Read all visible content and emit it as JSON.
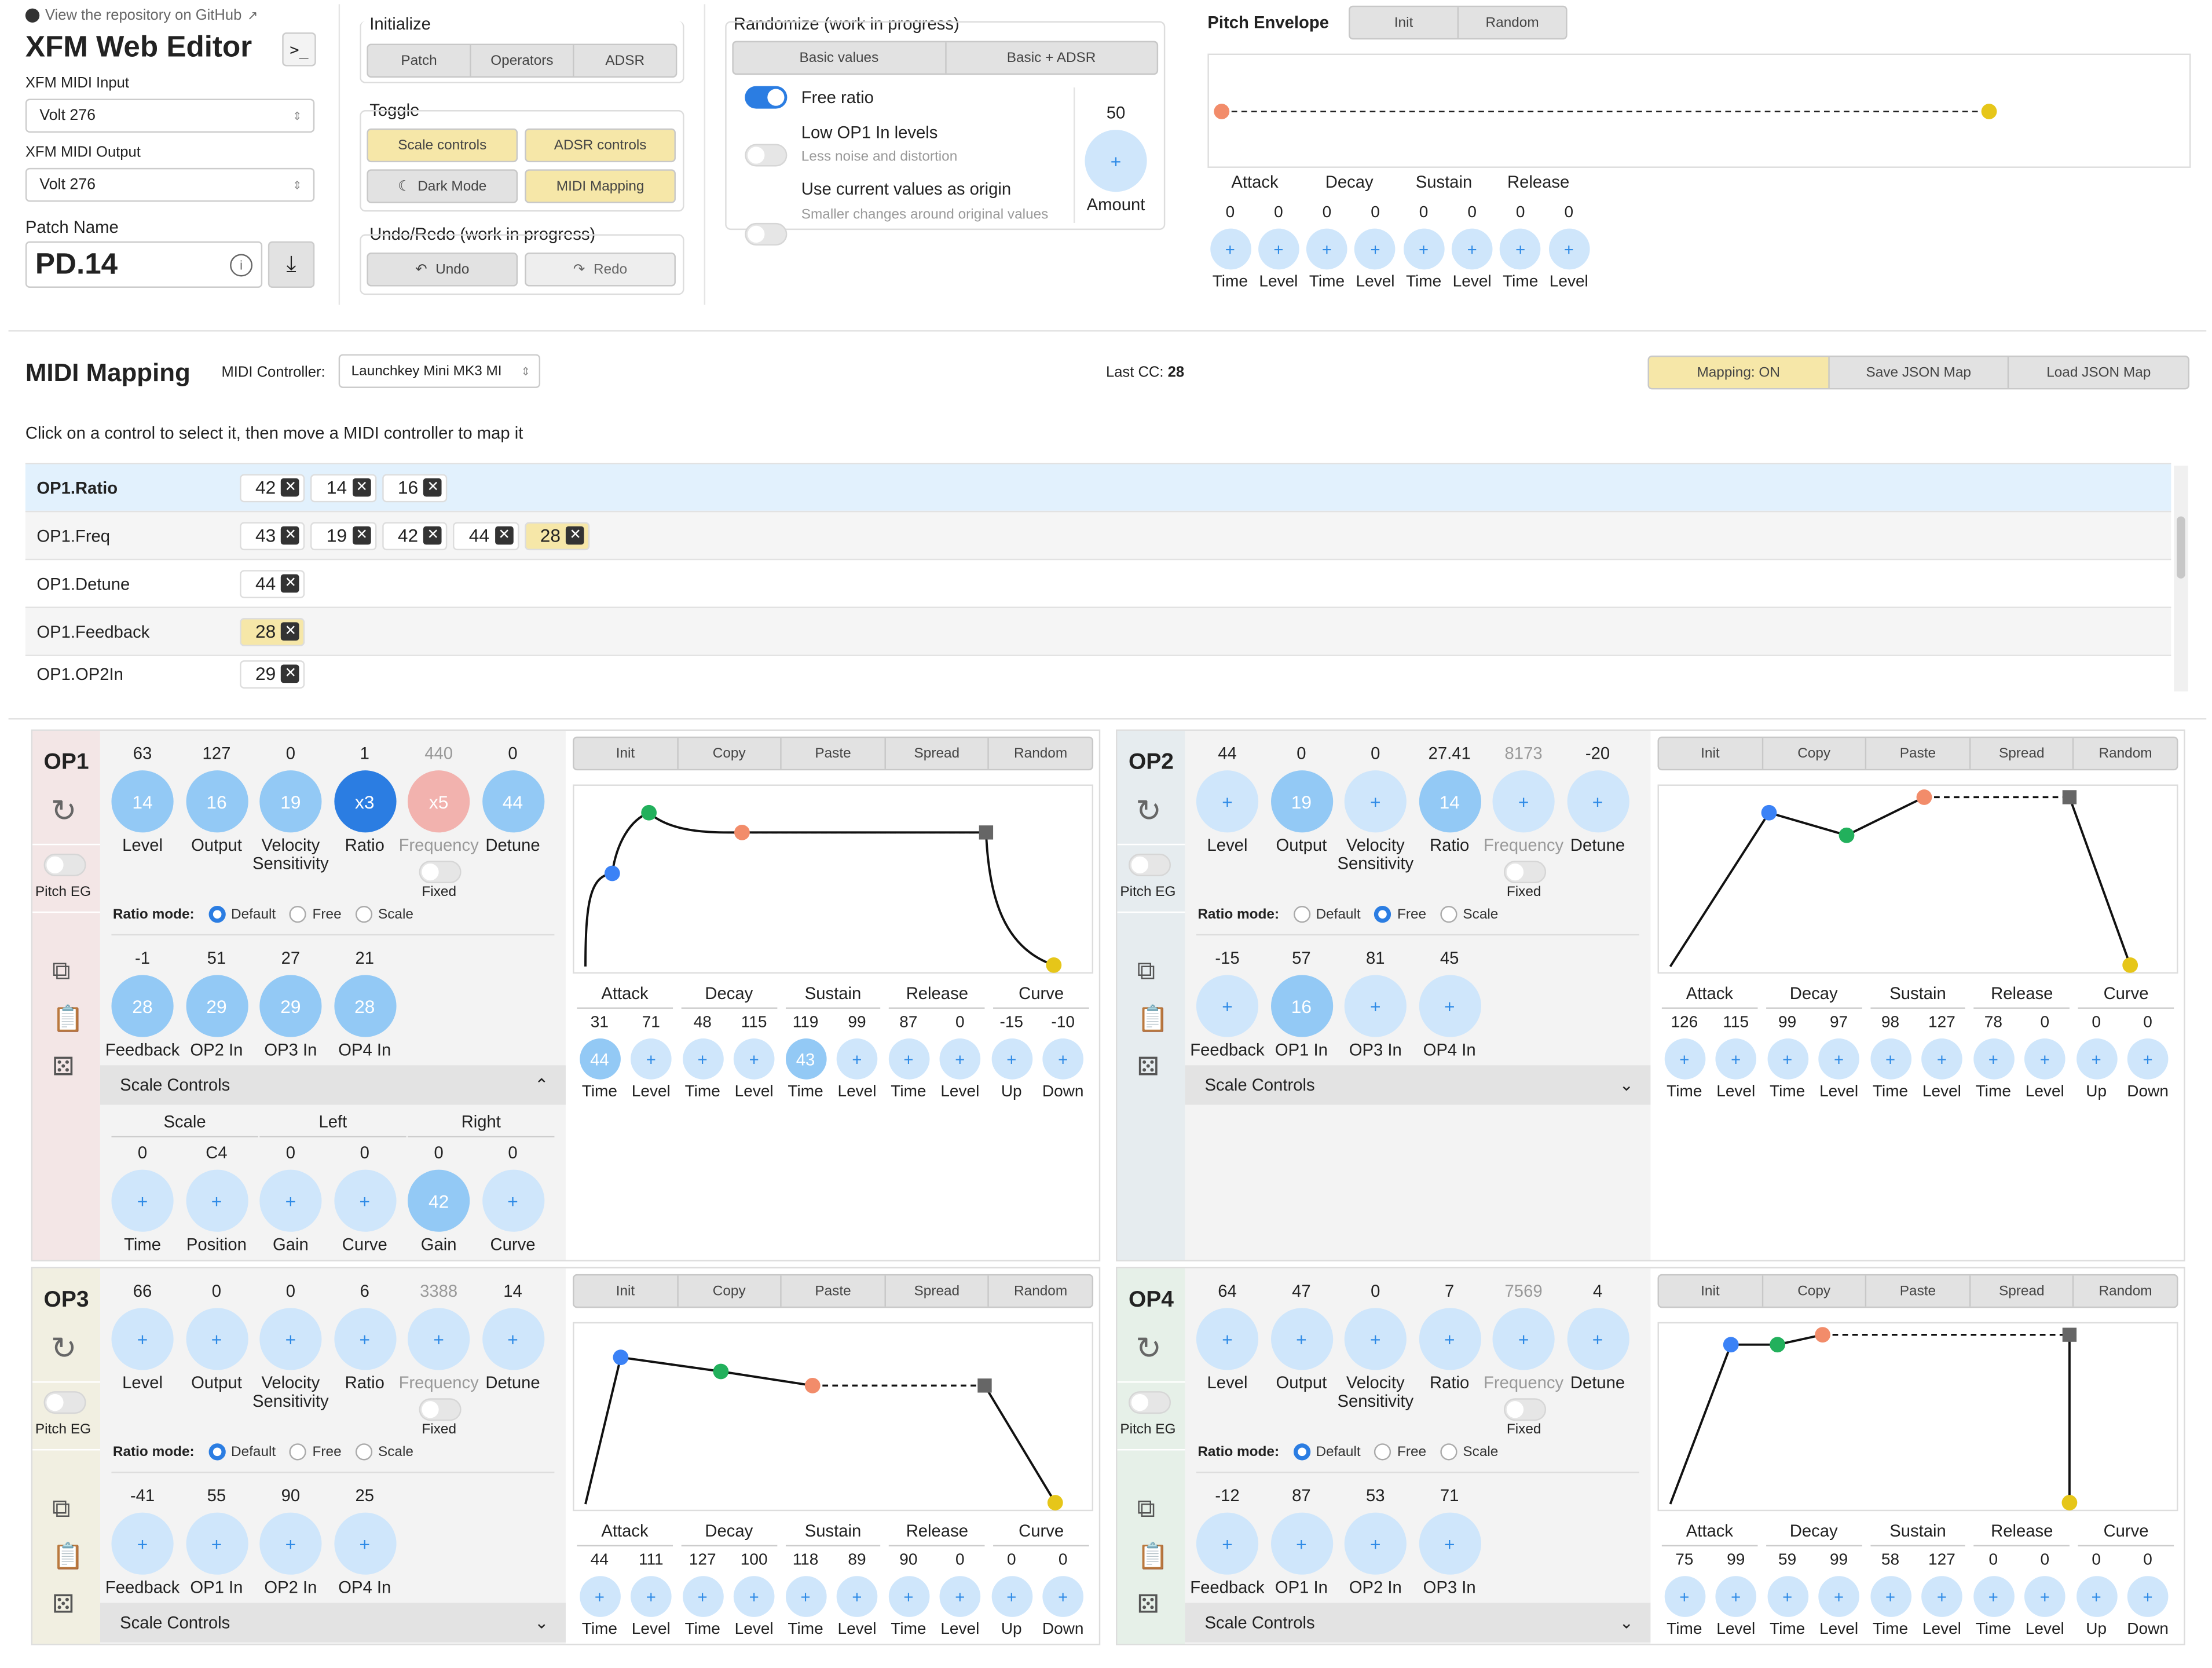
{
  "header": {
    "repo_link": "View the repository on GitHub",
    "title": "XFM Web Editor",
    "midi_input_label": "XFM MIDI Input",
    "midi_input_value": "Volt 276",
    "midi_output_label": "XFM MIDI Output",
    "midi_output_value": "Volt 276",
    "patch_name_label": "Patch Name",
    "patch_name_value": "PD.14"
  },
  "initialize": {
    "title": "Initialize",
    "buttons": [
      "Patch",
      "Operators",
      "ADSR"
    ]
  },
  "toggle": {
    "title": "Toggle",
    "scale_controls": "Scale controls",
    "adsr_controls": "ADSR controls",
    "dark_mode": "Dark Mode",
    "midi_mapping": "MIDI Mapping"
  },
  "undo": {
    "title": "Undo/Redo (work in progress)",
    "undo": "Undo",
    "redo": "Redo"
  },
  "randomize": {
    "title": "Randomize (work in progress)",
    "basic_values": "Basic values",
    "basic_adsr": "Basic + ADSR",
    "free_ratio": "Free ratio",
    "low_op1": "Low OP1 In levels",
    "low_op1_sub": "Less noise and distortion",
    "use_current": "Use current values as origin",
    "use_current_sub": "Smaller changes around original values",
    "amount_value": "50",
    "amount_label": "Amount",
    "free_ratio_on": true
  },
  "pitch_env": {
    "title": "Pitch Envelope",
    "init": "Init",
    "random": "Random",
    "headers": [
      "Attack",
      "Decay",
      "Sustain",
      "Release"
    ],
    "values": [
      "0",
      "0",
      "0",
      "0",
      "0",
      "0",
      "0",
      "0"
    ],
    "labels": [
      "Time",
      "Level",
      "Time",
      "Level",
      "Time",
      "Level",
      "Time",
      "Level"
    ]
  },
  "midi_mapping": {
    "title": "MIDI Mapping",
    "controller_label": "MIDI Controller:",
    "controller_value": "Launchkey Mini MK3 MI",
    "last_cc_label": "Last CC:",
    "last_cc_value": "28",
    "mapping_on": "Mapping: ON",
    "save": "Save JSON Map",
    "load": "Load JSON Map",
    "hint": "Click on a control to select it, then move a MIDI controller to map it",
    "rows": [
      {
        "name": "OP1.Ratio",
        "chips": [
          "42",
          "14",
          "16"
        ],
        "hl": []
      },
      {
        "name": "OP1.Freq",
        "chips": [
          "43",
          "19",
          "42",
          "44",
          "28"
        ],
        "hl": [
          4
        ]
      },
      {
        "name": "OP1.Detune",
        "chips": [
          "44"
        ],
        "hl": []
      },
      {
        "name": "OP1.Feedback",
        "chips": [
          "28"
        ],
        "hl": [
          0
        ]
      },
      {
        "name": "OP1.OP2In",
        "chips": [
          "29"
        ],
        "hl": []
      }
    ]
  },
  "common": {
    "ratio_mode": "Ratio mode:",
    "modes": [
      "Default",
      "Free",
      "Scale"
    ],
    "fixed": "Fixed",
    "pitch_eg": "Pitch EG",
    "scale_controls": "Scale Controls",
    "env_buttons": [
      "Init",
      "Copy",
      "Paste",
      "Spread",
      "Random"
    ],
    "env_headers": [
      "Attack",
      "Decay",
      "Sustain",
      "Release",
      "Curve"
    ],
    "env_labels": [
      "Time",
      "Level",
      "Time",
      "Level",
      "Time",
      "Level",
      "Time",
      "Level",
      "Up",
      "Down"
    ],
    "main_labels": [
      "Level",
      "Output",
      "Velocity\nSensitivity",
      "Ratio",
      "Frequency",
      "Detune"
    ]
  },
  "ops": [
    {
      "name": "OP1",
      "mode": 0,
      "main_values": [
        "63",
        "127",
        "0",
        "1",
        "440",
        "0"
      ],
      "main_knobs": [
        "14",
        "16",
        "19",
        "x3",
        "x5",
        "44"
      ],
      "mod_values": [
        "-1",
        "51",
        "27",
        "21"
      ],
      "mod_labels": [
        "Feedback",
        "OP2 In",
        "OP3 In",
        "OP4 In"
      ],
      "mod_knobs": [
        "28",
        "29",
        "29",
        "28"
      ],
      "env_values": [
        "31",
        "71",
        "48",
        "115",
        "119",
        "99",
        "87",
        "0",
        "-15",
        "-10"
      ],
      "env_knobs": [
        "44",
        "",
        "",
        "",
        "43",
        "",
        "",
        "",
        "",
        ""
      ],
      "scale_open": true,
      "scale": {
        "headers": [
          "Scale",
          "Left",
          "Right"
        ],
        "values": [
          "0",
          "C4",
          "0",
          "0",
          "0",
          "0"
        ],
        "labels": [
          "Time",
          "Position",
          "Gain",
          "Curve",
          "Gain",
          "Curve"
        ],
        "knobs": [
          "",
          "",
          "",
          "",
          "42",
          ""
        ]
      }
    },
    {
      "name": "OP2",
      "mode": 1,
      "main_values": [
        "44",
        "0",
        "0",
        "27.41",
        "8173",
        "-20"
      ],
      "main_knobs": [
        "",
        "19",
        "",
        "14",
        "",
        ""
      ],
      "mod_values": [
        "-15",
        "57",
        "81",
        "45"
      ],
      "mod_labels": [
        "Feedback",
        "OP1 In",
        "OP3 In",
        "OP4 In"
      ],
      "mod_knobs": [
        "",
        "16",
        "",
        ""
      ],
      "env_values": [
        "126",
        "115",
        "99",
        "97",
        "98",
        "127",
        "78",
        "0",
        "0",
        "0"
      ],
      "env_knobs": [
        "",
        "",
        "",
        "",
        "",
        "",
        "",
        "",
        "",
        ""
      ],
      "scale_open": false
    },
    {
      "name": "OP3",
      "mode": 0,
      "main_values": [
        "66",
        "0",
        "0",
        "6",
        "3388",
        "14"
      ],
      "main_knobs": [
        "",
        "",
        "",
        "",
        "",
        ""
      ],
      "mod_values": [
        "-41",
        "55",
        "90",
        "25"
      ],
      "mod_labels": [
        "Feedback",
        "OP1 In",
        "OP2 In",
        "OP4 In"
      ],
      "mod_knobs": [
        "",
        "",
        "",
        ""
      ],
      "env_values": [
        "44",
        "111",
        "127",
        "100",
        "118",
        "89",
        "90",
        "0",
        "0",
        "0"
      ],
      "env_knobs": [
        "",
        "",
        "",
        "",
        "",
        "",
        "",
        "",
        "",
        ""
      ],
      "scale_open": false
    },
    {
      "name": "OP4",
      "mode": 0,
      "main_values": [
        "64",
        "47",
        "0",
        "7",
        "7569",
        "4"
      ],
      "main_knobs": [
        "",
        "",
        "",
        "",
        "",
        ""
      ],
      "mod_values": [
        "-12",
        "87",
        "53",
        "71"
      ],
      "mod_labels": [
        "Feedback",
        "OP1 In",
        "OP2 In",
        "OP3 In"
      ],
      "mod_knobs": [
        "",
        "",
        "",
        ""
      ],
      "env_values": [
        "75",
        "99",
        "59",
        "99",
        "58",
        "127",
        "0",
        "0",
        "0",
        "0"
      ],
      "env_knobs": [
        "",
        "",
        "",
        "",
        "",
        "",
        "",
        "",
        "",
        ""
      ],
      "scale_open": false
    }
  ]
}
